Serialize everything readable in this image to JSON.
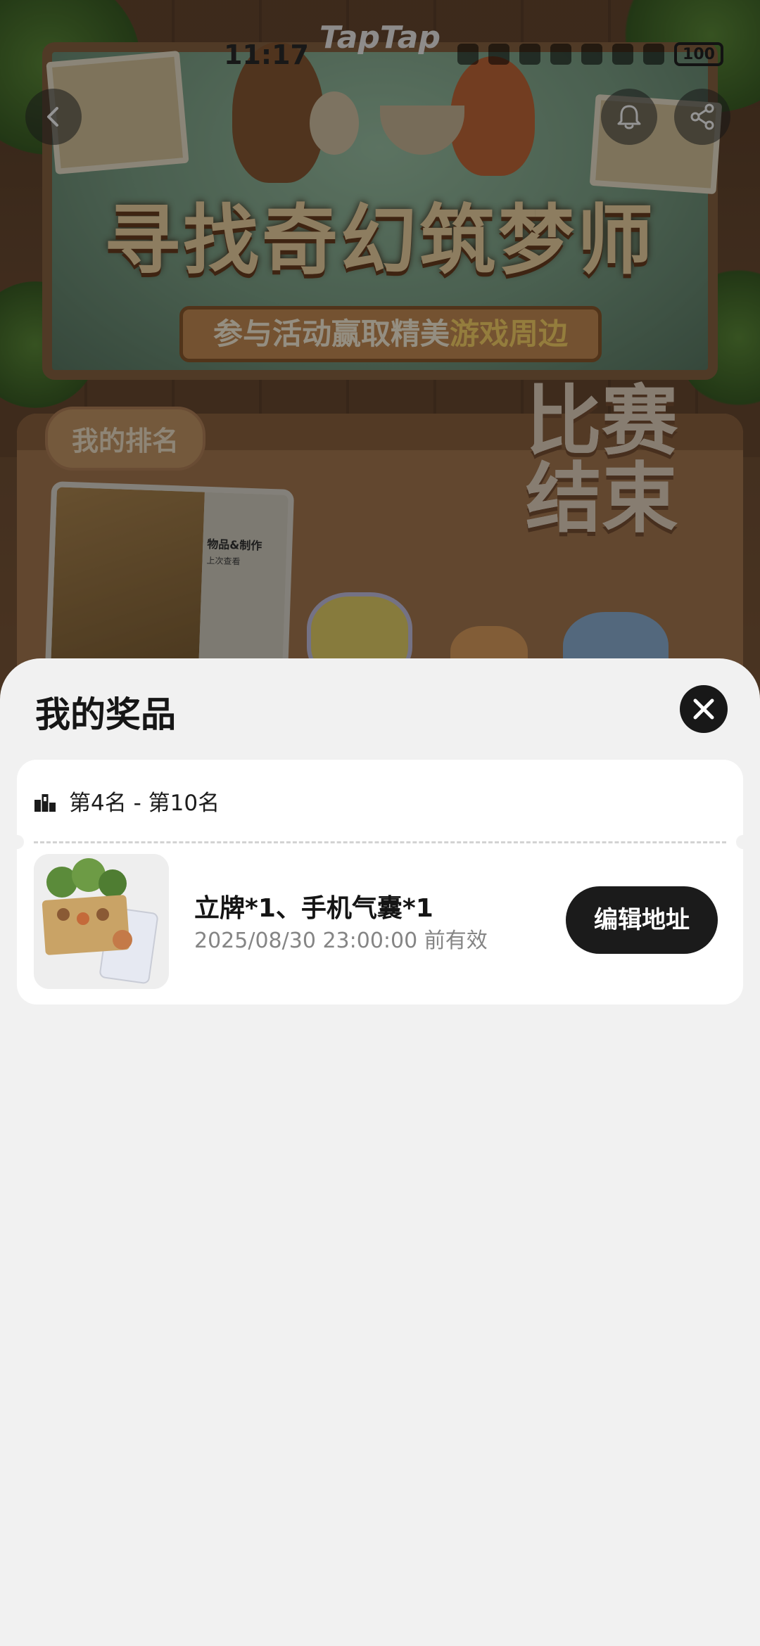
{
  "status_bar": {
    "time": "11:17",
    "battery": "100"
  },
  "brand": {
    "logo_text": "TapTap"
  },
  "event": {
    "title": "寻找奇幻筑梦师",
    "subtitle_main": "参与活动赢取精美",
    "subtitle_highlight": "游戏周边",
    "rank_tab": "我的排名",
    "ended_line1": "比赛",
    "ended_line2": "结束",
    "screenshot_menu_title": "物品&制作",
    "screenshot_menu_sub": "上次查看"
  },
  "sheet": {
    "title": "我的奖品",
    "rank_range": "第4名 - 第10名",
    "prize_name": "立牌*1、手机气囊*1",
    "prize_valid": "2025/08/30 23:00:00 前有效",
    "edit_address_label": "编辑地址"
  },
  "icons": {
    "back": "chevron-left-icon",
    "bell": "bell-icon",
    "share": "share-icon",
    "close": "close-icon",
    "podium": "podium-icon"
  },
  "colors": {
    "accent_dark": "#1b1b1b",
    "sheet_bg": "#f1f1f1",
    "card_bg": "#ffffff"
  }
}
